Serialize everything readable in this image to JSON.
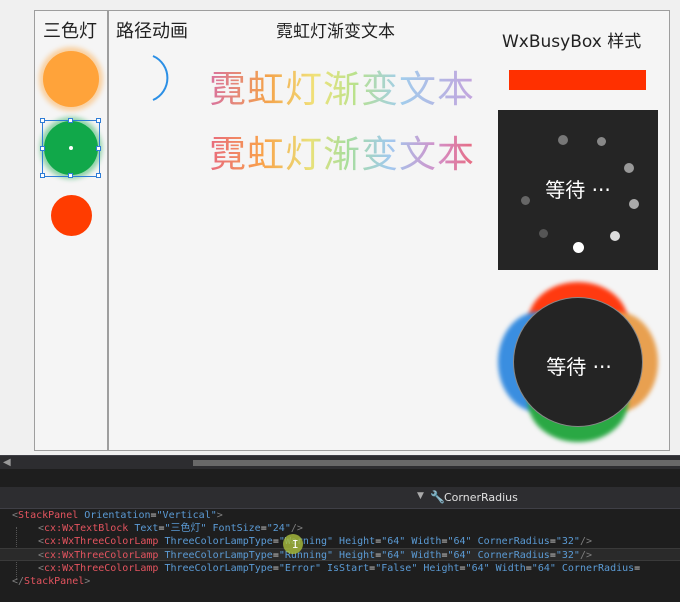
{
  "canvas": {
    "traffic_title": "三色灯",
    "path_title": "路径动画",
    "neon_title": "霓虹灯渐变文本",
    "neon_text_1": "霓虹灯渐变文本",
    "neon_text_2": "霓虹灯渐变文本",
    "busy_title": "WxBusyBox 样式",
    "busy_label_1": "等待 ···",
    "busy_label_2": "等待 ···",
    "lamp_colors": {
      "warning": "#ffa33a",
      "running": "#11a84a",
      "error": "#ff3c00"
    }
  },
  "breadcrumb": {
    "dropdown_icon": "chevron-down-icon",
    "icon": "wrench-icon",
    "label": "CornerRadius"
  },
  "code": {
    "line1": {
      "open": "<",
      "tag": "StackPanel",
      "a1": " Orientation",
      "eq": "=",
      "v1": "\"Vertical\"",
      "close": ">"
    },
    "line2": {
      "open": "<",
      "tag": "cx:WxTextBlock",
      "a1": " Text",
      "v1": "\"三色灯\"",
      "a2": " FontSize",
      "v2": "\"2",
      "v2b": "\"",
      "close": "/>"
    },
    "line3": {
      "open": "<",
      "tag": "cx:WxThreeColorLamp",
      "a1": " ThreeColorLampType",
      "v1": "\"Warning\"",
      "a2": " Height",
      "v2": "\"64\"",
      "a3": " Width",
      "v3": "\"64\"",
      "a4": " CornerRadius",
      "v4": "\"32\"",
      "close": "/>"
    },
    "line4": {
      "open": "<",
      "tag": "cx:WxThreeColorLamp",
      "a1": " ThreeColorLampType",
      "v1": "\"Running\"",
      "a2": " Height",
      "v2": "\"64\"",
      "a3": " Width",
      "v3": "\"64\"",
      "a4": " CornerRadius",
      "v4": "\"32\"",
      "close": "/>"
    },
    "line5": {
      "open": "<",
      "tag": "cx:WxThreeColorLamp",
      "a1": " ThreeColorLampType",
      "v1": "\"Error\"",
      "a2": " IsStart",
      "v2": "\"False\"",
      "a3": " Height",
      "v3": "\"64\"",
      "a4": " Width",
      "v4": "\"64\"",
      "a5": " CornerRadius",
      "v5": "="
    },
    "line6": {
      "open": "</",
      "tag": "StackPanel",
      "close": ">"
    }
  }
}
